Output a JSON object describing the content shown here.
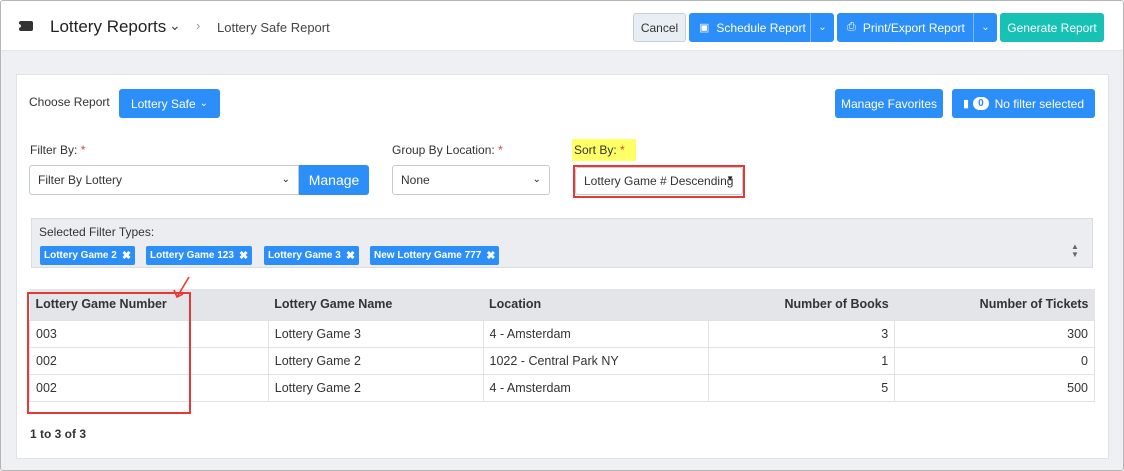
{
  "header": {
    "title": "Lottery Reports",
    "breadcrumb": "Lottery Safe Report",
    "cancel_label": "Cancel",
    "schedule_label": "Schedule Report",
    "print_label": "Print/Export Report",
    "generate_label": "Generate Report"
  },
  "report": {
    "choose_label": "Choose Report",
    "selected_report": "Lottery Safe",
    "manage_favorites_label": "Manage Favorites",
    "filter_count": "0",
    "filter_status": "No filter selected"
  },
  "filters": {
    "filter_by_label": "Filter By:",
    "filter_by_value": "Filter By Lottery",
    "manage_label": "Manage",
    "group_label": "Group By Location:",
    "group_value": "None",
    "sort_label": "Sort By:",
    "sort_value": "Lottery Game # Descending",
    "required_mark": "*",
    "selected_types_label": "Selected Filter Types:",
    "tags": [
      "Lottery Game 2",
      "Lottery Game 123",
      "Lottery Game 3",
      "New Lottery Game 777"
    ]
  },
  "table": {
    "columns": [
      "Lottery Game Number",
      "Lottery Game Name",
      "Location",
      "Number of Books",
      "Number of Tickets"
    ],
    "rows": [
      [
        "003",
        "Lottery Game 3",
        "4 - Amsterdam",
        "3",
        "300"
      ],
      [
        "002",
        "Lottery Game 2",
        "1022 - Central Park NY",
        "1",
        "0"
      ],
      [
        "002",
        "Lottery Game 2",
        "4 - Amsterdam",
        "5",
        "500"
      ]
    ],
    "pagination": "1 to 3 of 3"
  },
  "colors": {
    "primary": "#2c8ef8",
    "generate": "#17c1b3",
    "highlight": "#ffff66",
    "annotation": "#e53935"
  }
}
